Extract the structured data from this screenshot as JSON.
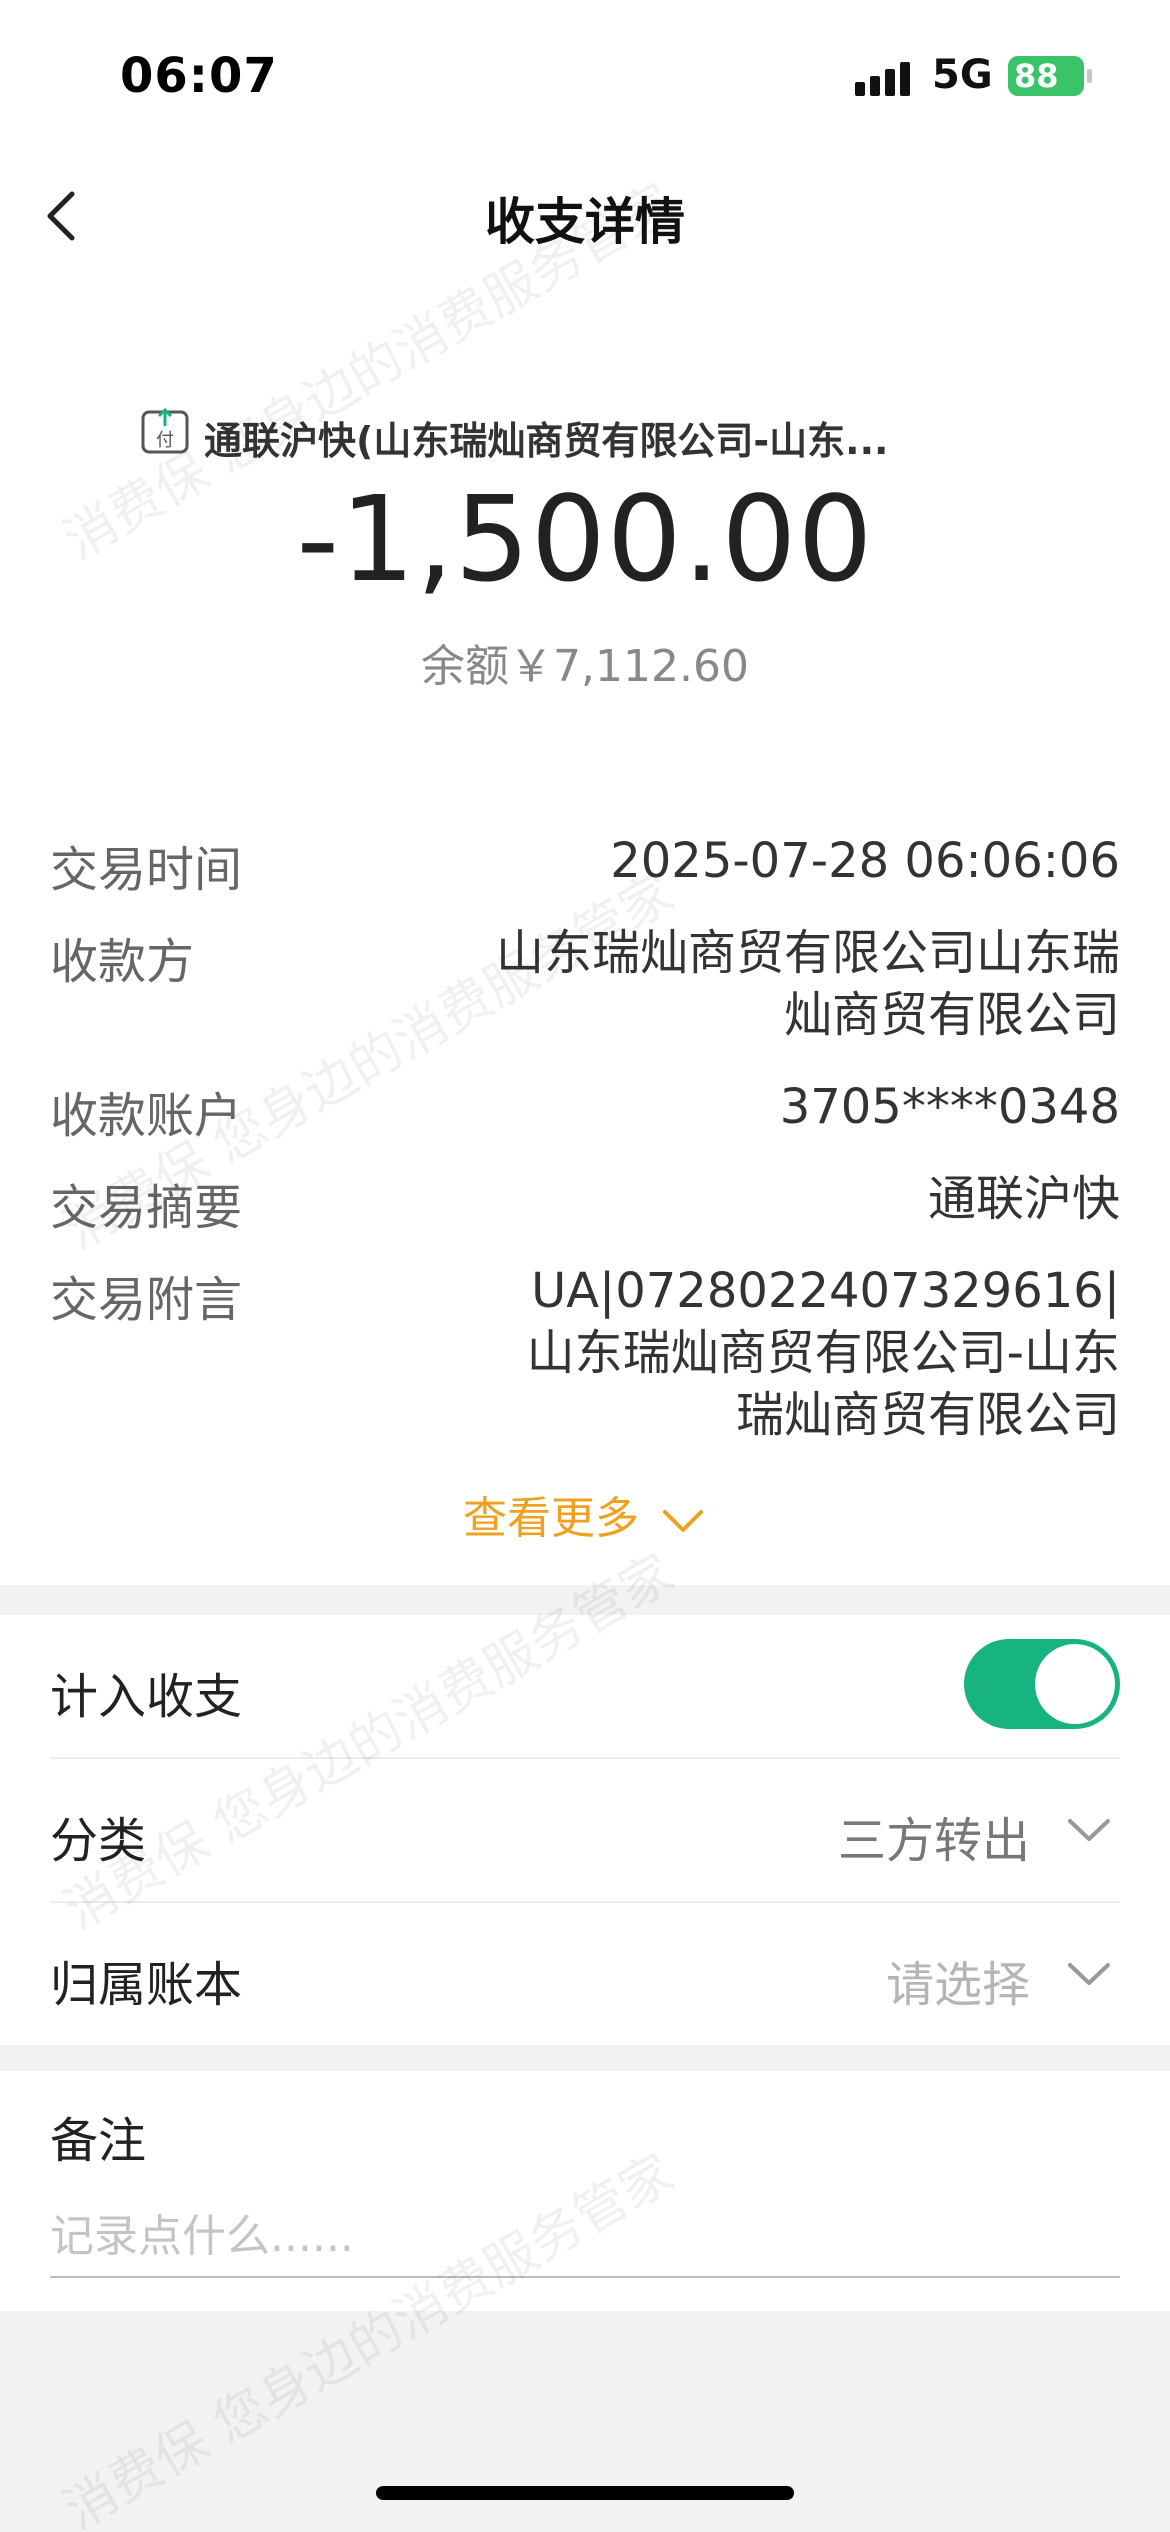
{
  "status_bar": {
    "time": "06:07",
    "network": "5G",
    "battery": "88"
  },
  "header": {
    "title": "收支详情",
    "back_icon": "chevron-left-icon"
  },
  "transaction": {
    "type_icon": "pay-icon",
    "type_icon_text": "付",
    "merchant": "通联沪快(山东瑞灿商贸有限公司-山东...",
    "amount": "-1,500.00",
    "balance": "余额￥7,112.60"
  },
  "details": [
    {
      "label": "交易时间",
      "value": "2025-07-28 06:06:06"
    },
    {
      "label": "收款方",
      "value": "山东瑞灿商贸有限公司山东瑞灿商贸有限公司"
    },
    {
      "label": "收款账户",
      "value": "3705****0348"
    },
    {
      "label": "交易摘要",
      "value": "通联沪快"
    },
    {
      "label": "交易附言",
      "value": "UA|0728022407329616|山东瑞灿商贸有限公司-山东瑞灿商贸有限公司"
    }
  ],
  "see_more": "查看更多",
  "settings": {
    "include_label": "计入收支",
    "include_on": true,
    "category_label": "分类",
    "category_value": "三方转出",
    "ledger_label": "归属账本",
    "ledger_placeholder": "请选择"
  },
  "remark": {
    "title": "备注",
    "placeholder": "记录点什么......"
  },
  "watermark": "消费保 您身边的消费服务管家",
  "colors": {
    "accent_green": "#17b47f",
    "see_more_orange": "#f0a020",
    "battery_green": "#3bc36a"
  }
}
